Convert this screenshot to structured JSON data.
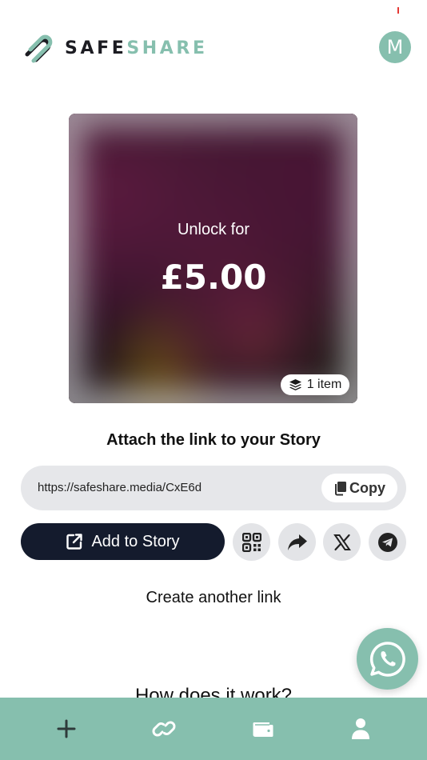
{
  "header": {
    "logo_text_dark": "SAFE",
    "logo_text_accent": "SHARE",
    "avatar_initial": "M",
    "logo_icon": "paperclip-icon"
  },
  "preview": {
    "unlock_label": "Unlock for",
    "price": "£5.00",
    "item_count": "1 item",
    "item_icon": "layers-icon"
  },
  "share": {
    "title": "Attach the link to your Story",
    "link_url": "https://safeshare.media/CxE6d",
    "copy_label": "Copy",
    "add_story_label": "Add to Story",
    "buttons": [
      "qr-code-icon",
      "share-arrow-icon",
      "x-icon",
      "telegram-icon"
    ]
  },
  "create_link_label": "Create another link",
  "how_works_title": "How does it work?",
  "bottom_nav": {
    "items": [
      "plus-icon",
      "link-icon",
      "wallet-icon",
      "user-icon"
    ]
  },
  "colors": {
    "accent": "#86bfae",
    "dark_button": "#141b2d",
    "pill_bg": "#e6e7ea"
  }
}
